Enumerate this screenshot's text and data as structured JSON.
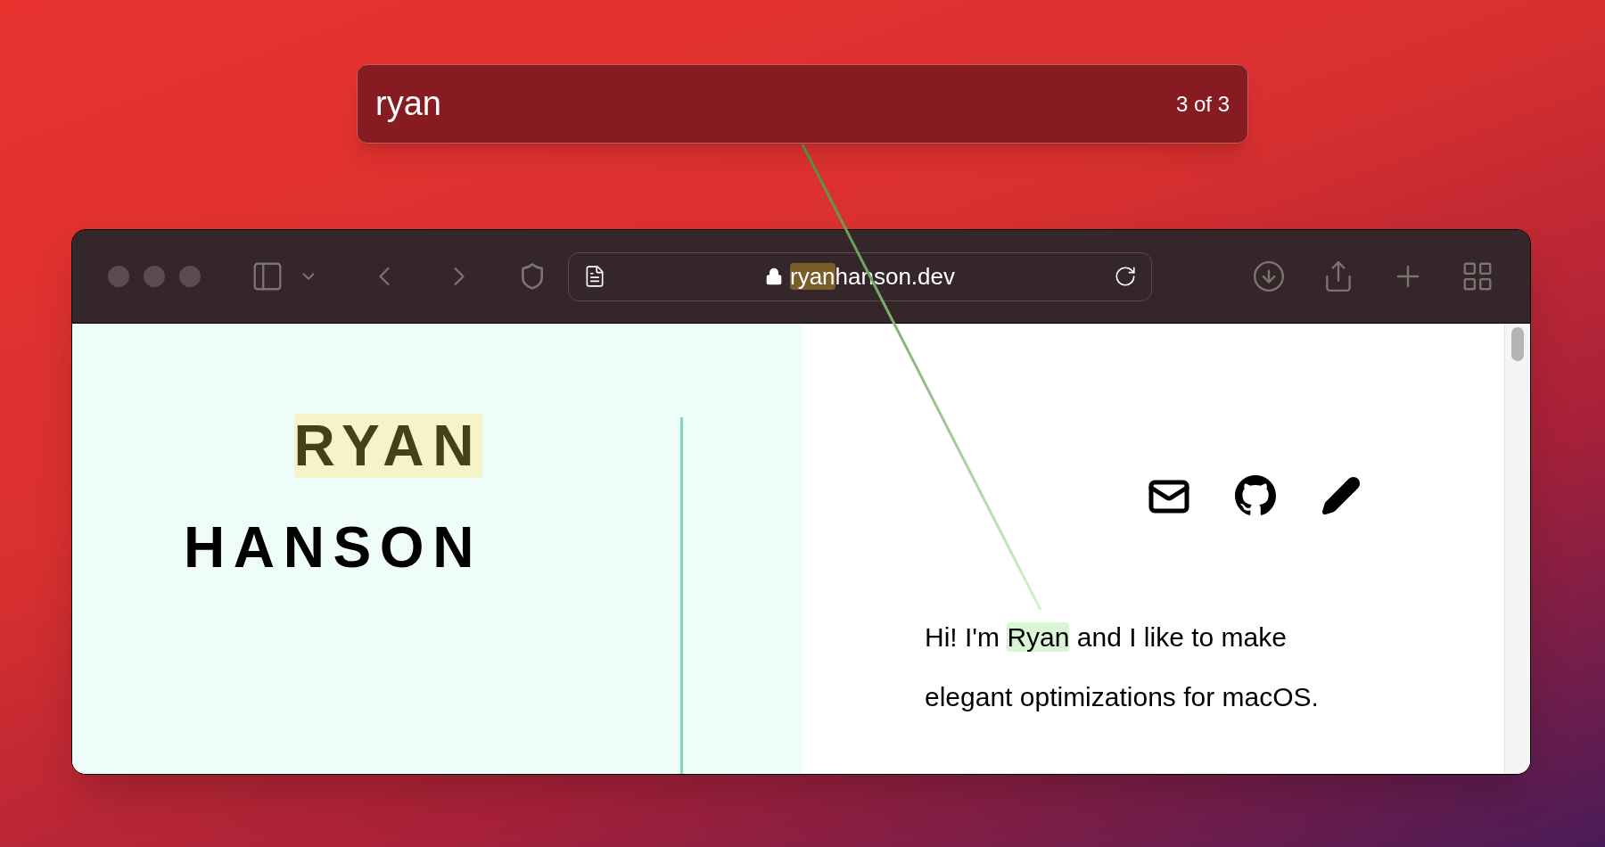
{
  "find_bar": {
    "query": "ryan",
    "match_count": "3 of 3"
  },
  "toolbar": {
    "address": [
      {
        "text": "ryan",
        "highlighted": true,
        "current": false
      },
      {
        "text": "hanson.dev",
        "highlighted": false,
        "current": false
      }
    ]
  },
  "page": {
    "name_lines": [
      [
        {
          "text": "RYAN",
          "highlighted": true,
          "current": false
        }
      ],
      [
        {
          "text": "HANSON",
          "highlighted": false,
          "current": false
        }
      ]
    ],
    "intro": [
      {
        "text": "Hi! I'm ",
        "highlighted": false,
        "current": false
      },
      {
        "text": "Ryan",
        "highlighted": true,
        "current": true
      },
      {
        "text": " and I like to make elegant optimizations for macOS.",
        "highlighted": false,
        "current": false
      }
    ]
  }
}
